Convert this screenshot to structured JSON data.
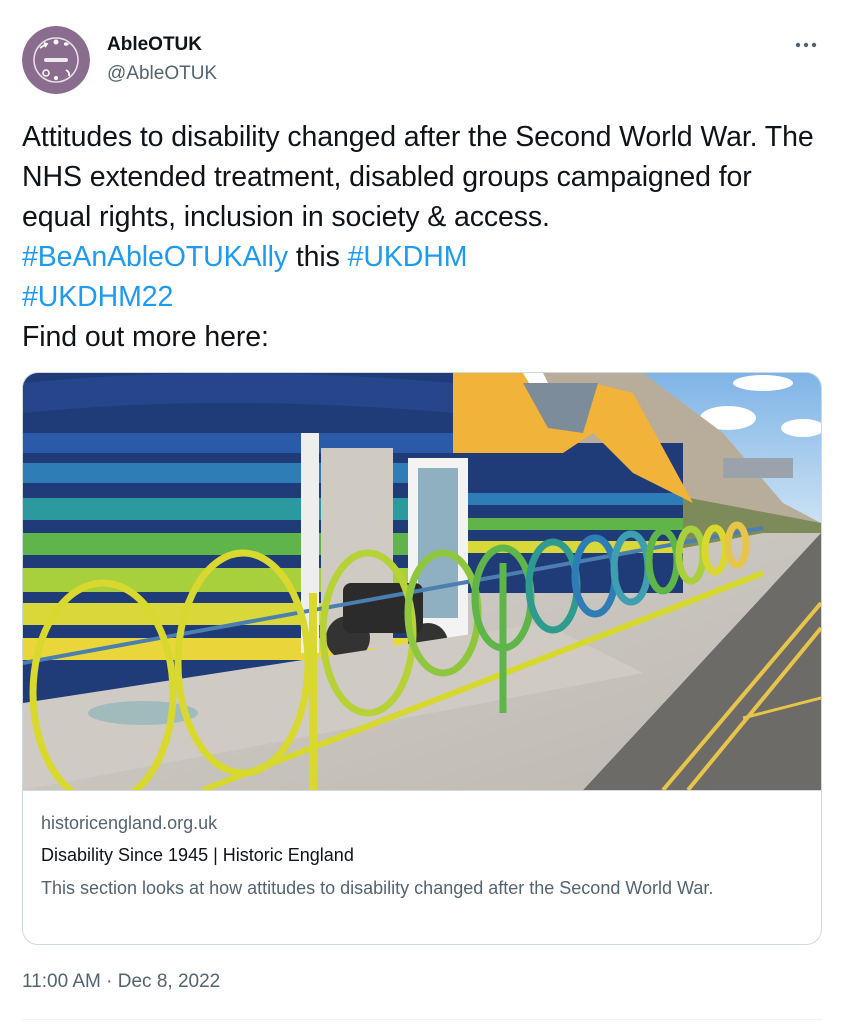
{
  "author": {
    "display_name": "AbleOTUK",
    "handle": "@AbleOTUK",
    "avatar": "ableotuk-logo"
  },
  "tweet": {
    "text_1": "Attitudes to disability changed after the Second World War. The NHS extended treatment, disabled groups campaigned for equal rights, inclusion in society & access. ",
    "hashtag_1": "#BeAnAbleOTUKAlly",
    "text_2": " this ",
    "hashtag_2": "#UKDHM",
    "hashtag_3": "#UKDHM22",
    "text_3": "Find out more here:"
  },
  "card": {
    "image_alt": "Colourful beach huts with wavy yellow and green railings along a seafront promenade",
    "domain": "historicengland.org.uk",
    "title": "Disability Since 1945 | Historic England",
    "description": "This section looks at how attitudes to disability changed after the Second World War."
  },
  "meta": {
    "time": "11:00 AM",
    "separator": " · ",
    "date": "Dec 8, 2022"
  },
  "colors": {
    "link": "#1d9bf0",
    "secondary_text": "#536471",
    "avatar_bg": "#8a6c8e"
  },
  "icons": {
    "more": "more-horizontal-icon"
  }
}
